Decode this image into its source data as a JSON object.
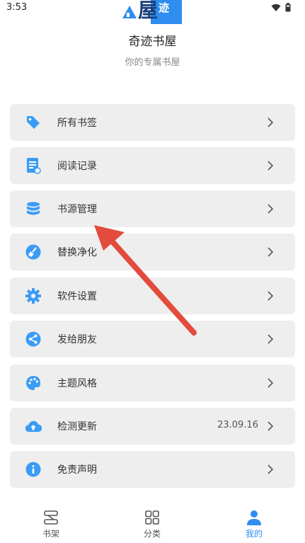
{
  "status": {
    "time": "3:53"
  },
  "header": {
    "app_name": "奇迹书屋",
    "slogan": "你的专属书屋",
    "logo_text": "屋 迹"
  },
  "colors": {
    "accent": "#2f8df0",
    "icon_blue": "#3b9cf5",
    "annotation_arrow": "#e34b3c"
  },
  "menu": {
    "items": [
      {
        "label": "所有书签",
        "icon": "tag-icon"
      },
      {
        "label": "阅读记录",
        "icon": "document-icon"
      },
      {
        "label": "书源管理",
        "icon": "database-icon"
      },
      {
        "label": "替换净化",
        "icon": "broom-icon"
      },
      {
        "label": "软件设置",
        "icon": "gear-icon"
      },
      {
        "label": "发给朋友",
        "icon": "share-icon"
      },
      {
        "label": "主题风格",
        "icon": "palette-icon"
      },
      {
        "label": "检测更新",
        "icon": "cloud-upload-icon",
        "value": "23.09.16"
      },
      {
        "label": "免责声明",
        "icon": "info-icon"
      }
    ]
  },
  "nav": {
    "tabs": [
      {
        "label": "书架",
        "icon": "bookshelf-icon",
        "active": false
      },
      {
        "label": "分类",
        "icon": "grid-icon",
        "active": false
      },
      {
        "label": "我的",
        "icon": "person-icon",
        "active": true
      }
    ]
  }
}
